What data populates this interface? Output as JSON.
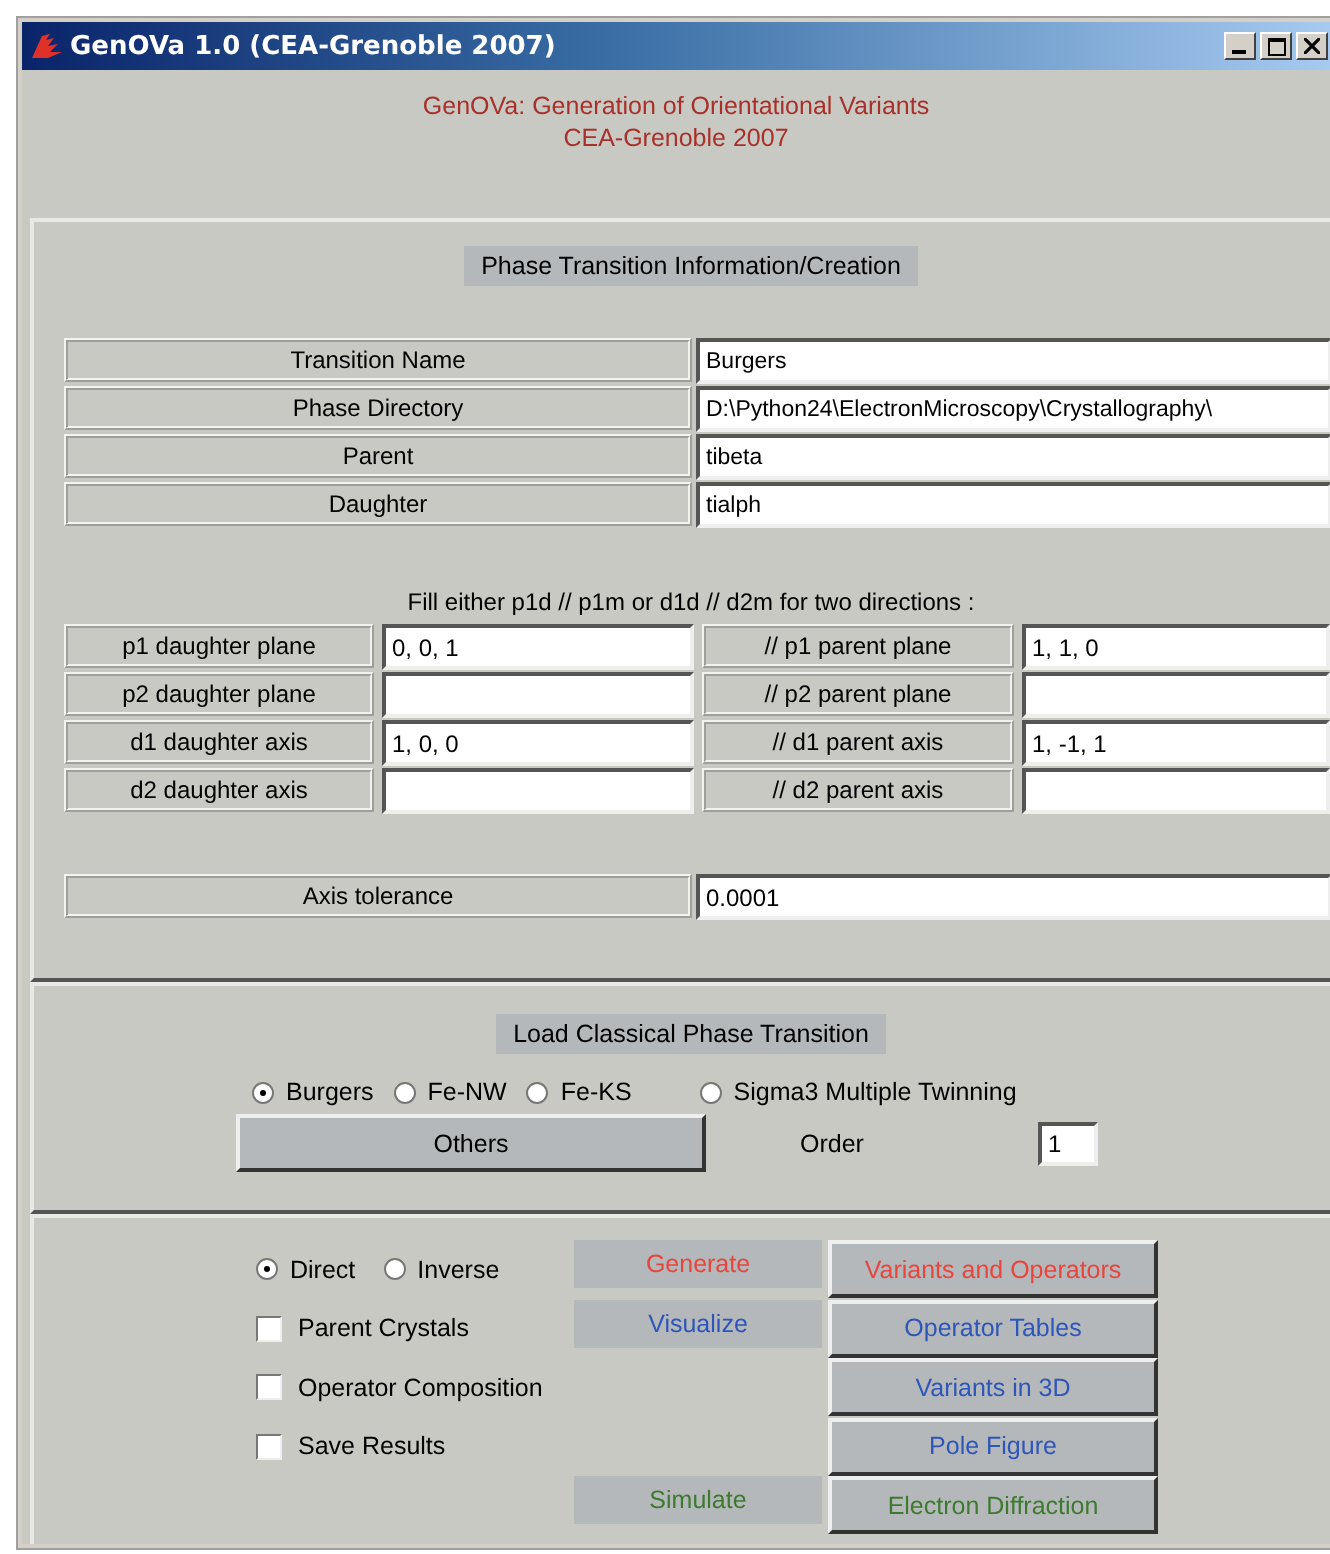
{
  "window": {
    "title": "GenOVa 1.0 (CEA-Grenoble 2007)"
  },
  "header": {
    "line1": "GenOVa: Generation of Orientational Variants",
    "line2": "CEA-Grenoble 2007"
  },
  "phase": {
    "heading": "Phase Transition Information/Creation",
    "fields": [
      {
        "label": "Transition Name",
        "value": "Burgers"
      },
      {
        "label": "Phase Directory",
        "value": "D:\\Python24\\ElectronMicroscopy\\Crystallography\\"
      },
      {
        "label": "Parent",
        "value": "tibeta"
      },
      {
        "label": "Daughter",
        "value": "tialph"
      }
    ],
    "hint": "Fill either p1d // p1m or d1d // d2m for two directions :",
    "planes": [
      {
        "label": "p1 daughter plane",
        "value": "0, 0, 1",
        "parent_label": "// p1 parent plane",
        "parent_value": "1, 1, 0"
      },
      {
        "label": "p2 daughter plane",
        "parent_label": "// p2 parent plane"
      },
      {
        "label": "d1 daughter axis",
        "value": "1, 0, 0",
        "parent_label": "// d1 parent axis",
        "parent_value": "1, -1, 1"
      },
      {
        "label": "d2 daughter axis",
        "parent_label": "// d2 parent axis"
      }
    ],
    "tolerance": {
      "label": "Axis tolerance",
      "value": "0.0001"
    }
  },
  "classical": {
    "heading": "Load Classical Phase Transition",
    "options": [
      {
        "label": "Burgers",
        "selected": true
      },
      {
        "label": "Fe-NW",
        "selected": false
      },
      {
        "label": "Fe-KS",
        "selected": false
      },
      {
        "label": "Sigma3 Multiple Twinning",
        "selected": false
      }
    ],
    "others_button": "Others",
    "order": {
      "label": "Order",
      "value": "1"
    }
  },
  "actions": {
    "mode": [
      {
        "label": "Direct",
        "selected": true
      },
      {
        "label": "Inverse",
        "selected": false
      }
    ],
    "checks": [
      {
        "label": "Parent Crystals",
        "checked": false
      },
      {
        "label": "Operator Composition",
        "checked": false
      },
      {
        "label": "Save Results",
        "checked": false
      }
    ],
    "rows": [
      {
        "label": "Generate",
        "button": "Variants and Operators",
        "color": "#e8453c"
      },
      {
        "label": "Visualize",
        "button": "Operator Tables",
        "color": "#2e56b8"
      },
      {
        "button": "Variants in 3D",
        "color": "#2e56b8"
      },
      {
        "button": "Pole Figure",
        "color": "#2e56b8"
      },
      {
        "label": "Simulate",
        "button": "Electron Diffraction",
        "color": "#3d7a2e"
      }
    ]
  }
}
